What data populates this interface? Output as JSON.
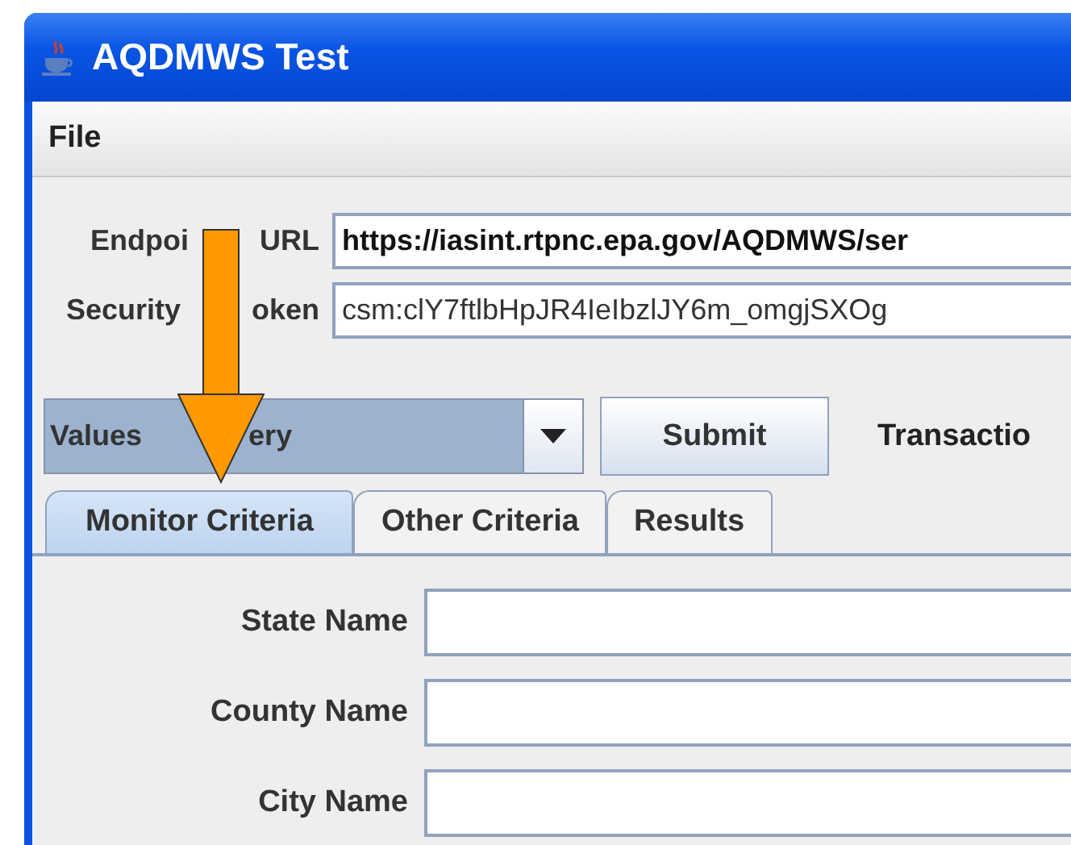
{
  "window": {
    "title": "AQDMWS Test"
  },
  "menu": [
    "File"
  ],
  "fields": [
    {
      "label_parts": [
        "Endpoi",
        "URL"
      ],
      "value": "https://iasint.rtpnc.epa.gov/AQDMWS/ser",
      "bold": true
    },
    {
      "label_parts": [
        "Security",
        "oken"
      ],
      "value": "csm:clY7ftlbHpJR4IeIbzlJY6m_omgjSXOg",
      "bold": false
    }
  ],
  "query": {
    "selection_parts": [
      "Values",
      "ery"
    ],
    "submit": "Submit",
    "status_label": "Transactio"
  },
  "tabs": [
    {
      "label": "Monitor Criteria",
      "selected": true
    },
    {
      "label": "Other Criteria",
      "selected": false
    },
    {
      "label": "Results",
      "selected": false
    }
  ],
  "criteria": [
    {
      "label": "State Name"
    },
    {
      "label": "County Name"
    },
    {
      "label": "City Name"
    }
  ]
}
